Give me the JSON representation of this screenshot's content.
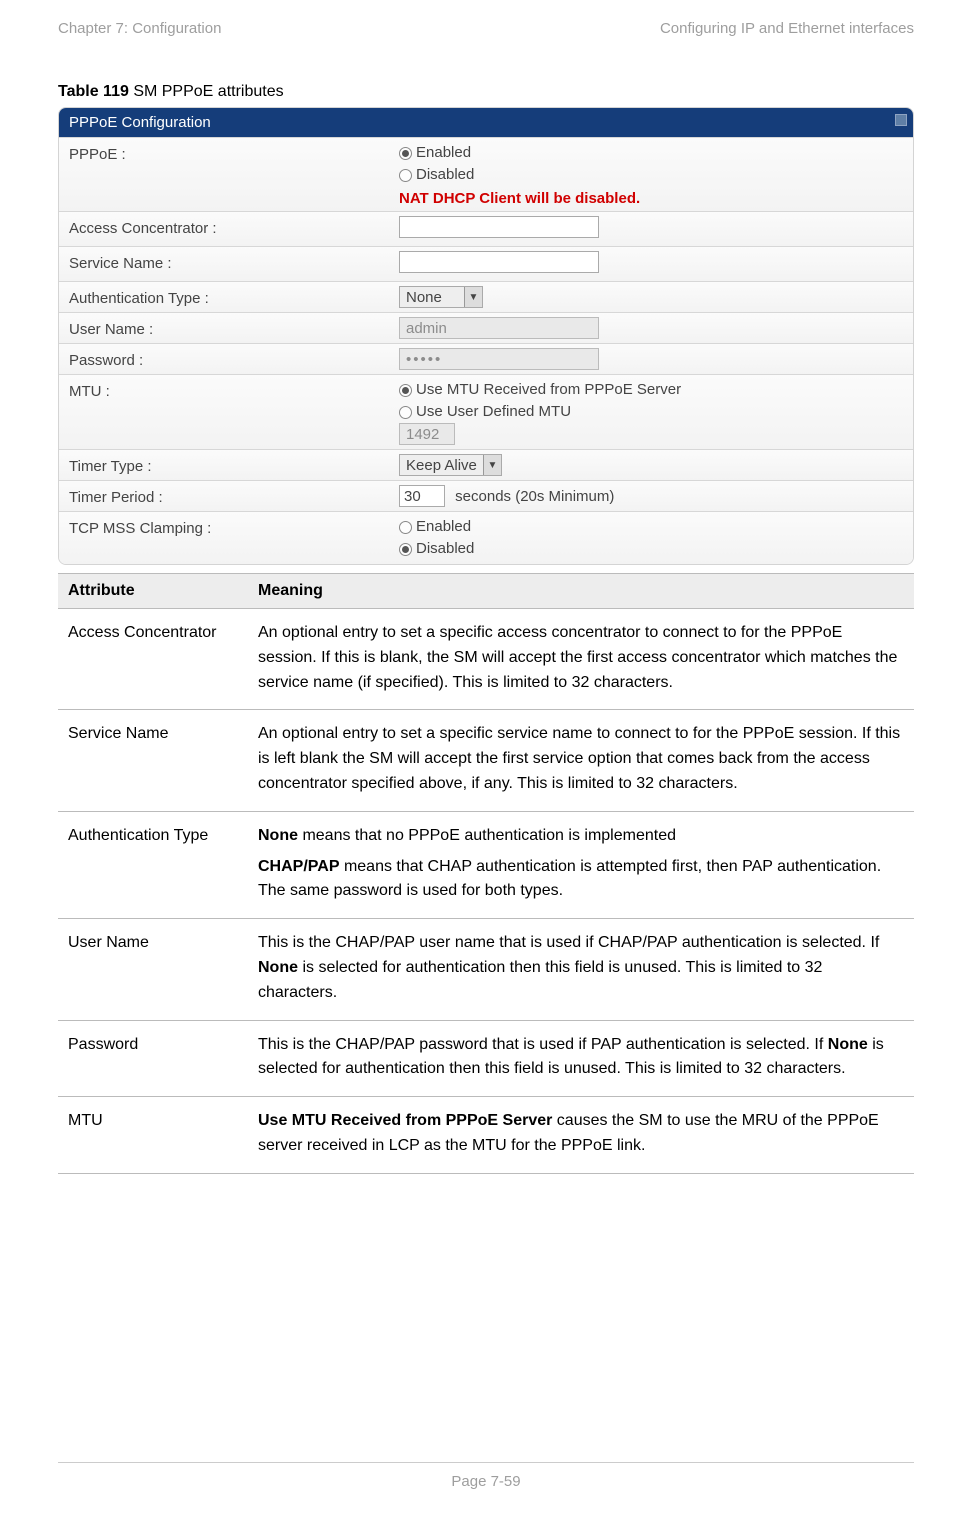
{
  "header": {
    "left": "Chapter 7:  Configuration",
    "right": "Configuring IP and Ethernet interfaces"
  },
  "caption": {
    "prefix": "Table 119 ",
    "title": "SM PPPoE attributes"
  },
  "panel": {
    "title": "PPPoE Configuration",
    "rows": {
      "pppoe": {
        "label": "PPPoE :",
        "opt_enabled": "Enabled",
        "opt_disabled": "Disabled",
        "warning": "NAT DHCP Client will be disabled."
      },
      "ac": {
        "label": "Access Concentrator :"
      },
      "service": {
        "label": "Service Name :"
      },
      "auth": {
        "label": "Authentication Type :",
        "value": "None"
      },
      "user": {
        "label": "User Name :",
        "value": "admin"
      },
      "pass": {
        "label": "Password :",
        "value": "•••••"
      },
      "mtu": {
        "label": "MTU :",
        "opt1": "Use MTU Received from PPPoE Server",
        "opt2": "Use User Defined MTU",
        "value": "1492"
      },
      "timer_type": {
        "label": "Timer Type :",
        "value": "Keep Alive"
      },
      "timer_period": {
        "label": "Timer Period :",
        "value": "30",
        "suffix": "seconds (20s Minimum)"
      },
      "clamp": {
        "label": "TCP MSS Clamping :",
        "opt_enabled": "Enabled",
        "opt_disabled": "Disabled"
      }
    }
  },
  "table": {
    "head": {
      "attr": "Attribute",
      "meaning": "Meaning"
    },
    "rows": [
      {
        "attr": "Access Concentrator",
        "meaning": "An optional entry to set a specific access concentrator to connect to for the PPPoE session. If this is blank, the SM will accept the first access concentrator which matches the service name (if specified). This is limited to 32 characters."
      },
      {
        "attr": "Service Name",
        "meaning": "An optional entry to set a specific service name to connect to for the PPPoE session. If this is left blank the SM will accept the first service option that comes back from the access concentrator specified above, if any. This is limited to 32 characters."
      },
      {
        "attr": "Authentication Type",
        "p1a": "None",
        "p1b": " means that no PPPoE authentication is implemented",
        "p2a": "CHAP/PAP",
        "p2b": " means that CHAP authentication is attempted first, then PAP authentication. The same password is used for both types."
      },
      {
        "attr": "User Name",
        "pre": "This is the CHAP/PAP user name that is used if CHAP/PAP authentication is selected. If ",
        "bold": "None",
        "post": " is selected for authentication then this field is unused. This is limited to 32 characters."
      },
      {
        "attr": "Password",
        "pre": "This is the CHAP/PAP password that is used if PAP authentication is selected. If ",
        "bold": "None",
        "post": " is selected for authentication then this field is unused. This is limited to 32 characters."
      },
      {
        "attr": "MTU",
        "bold": "Use MTU Received from PPPoE Server",
        "post": " causes the SM to use the MRU of the PPPoE server received in LCP as the MTU for the PPPoE link."
      }
    ]
  },
  "footer": "Page 7-59"
}
